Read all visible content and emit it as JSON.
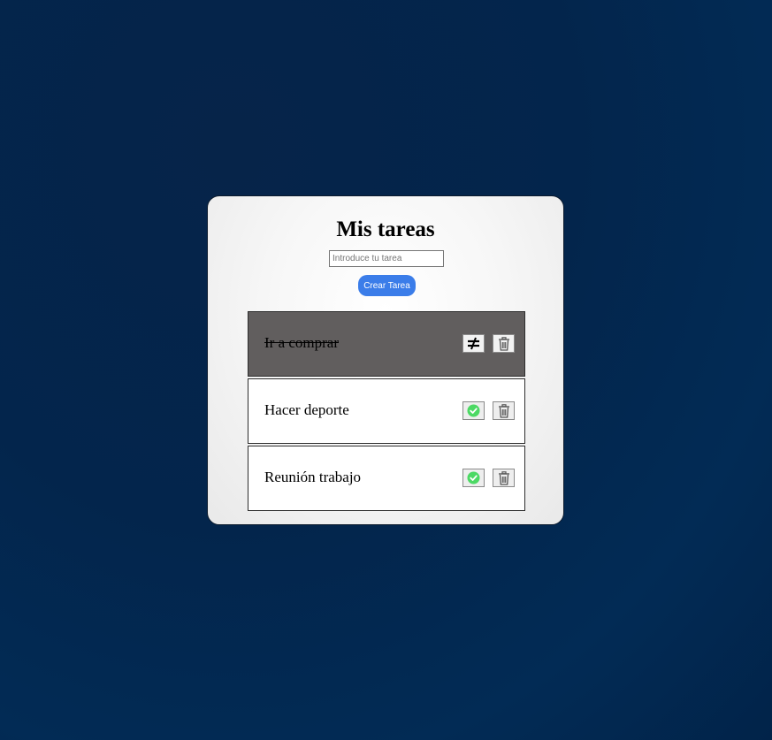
{
  "app": {
    "title": "Mis tareas"
  },
  "form": {
    "input_value": "",
    "input_placeholder": "Introduce tu tarea",
    "create_button_label": "Crear Tarea"
  },
  "tasks": [
    {
      "label": "Ir a comprar",
      "completed": true,
      "toggle_icon": "not-equal-icon",
      "delete_icon": "trash-icon"
    },
    {
      "label": "Hacer deporte",
      "completed": false,
      "toggle_icon": "check-circle-icon",
      "delete_icon": "trash-icon"
    },
    {
      "label": "Reunión trabajo",
      "completed": false,
      "toggle_icon": "check-circle-icon",
      "delete_icon": "trash-icon"
    }
  ],
  "colors": {
    "accent": "#3b7de9",
    "completed_task_bg": "#615e5e",
    "check_green": "#4cd964",
    "page_bg": "#03254c"
  }
}
